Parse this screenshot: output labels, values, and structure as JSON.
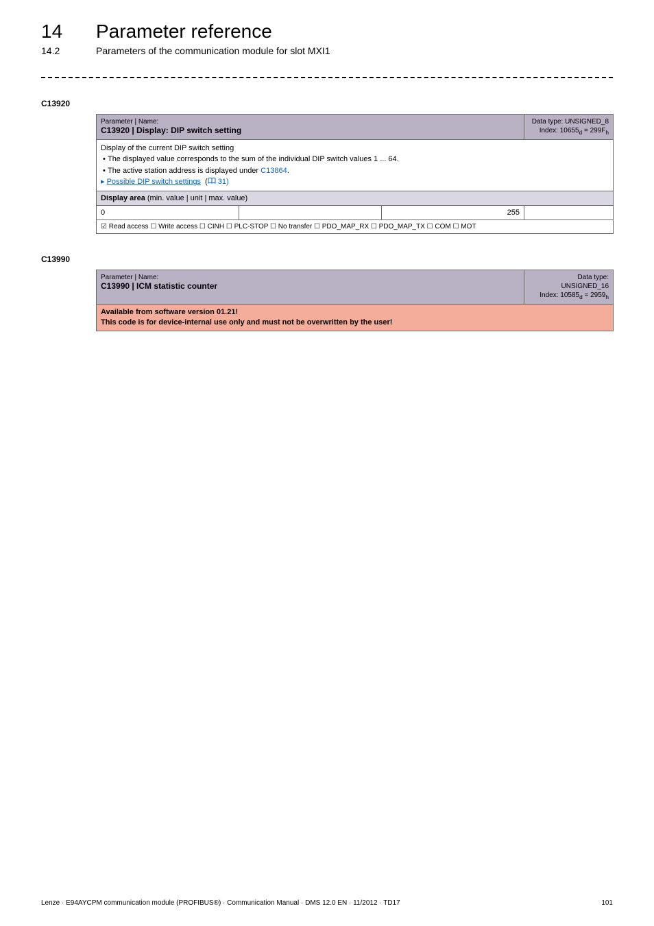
{
  "header": {
    "chapter_num": "14",
    "chapter_title": "Parameter reference",
    "section_num": "14.2",
    "section_title": "Parameters of the communication module for slot MXI1"
  },
  "param1": {
    "code": "C13920",
    "name_label": "Parameter | Name:",
    "name_value": "C13920 | Display: DIP switch setting",
    "data_type_line": "Data type: UNSIGNED_8",
    "index_line": "Index: 10655d = 299Fh",
    "desc_line1": "Display of the current DIP switch setting",
    "desc_bullet1a": "The displayed value corresponds to the sum of the individual DIP switch values 1 ... 64.",
    "desc_bullet2_prefix": "The active station address is displayed under ",
    "desc_bullet2_link": "C13864",
    "desc_bullet2_suffix": ".",
    "desc_link_prefix": "▸ ",
    "desc_link_text": "Possible DIP switch settings",
    "desc_link_page": " 31)",
    "display_area_label": "Display area (min. value | unit | max. value)",
    "display_min": "0",
    "display_max": "255",
    "access_line": "☑ Read access   ☐ Write access   ☐ CINH   ☐ PLC-STOP   ☐ No transfer   ☐ PDO_MAP_RX   ☐ PDO_MAP_TX   ☐ COM   ☐ MOT"
  },
  "param2": {
    "code": "C13990",
    "name_label": "Parameter | Name:",
    "name_value": "C13990 | ICM statistic counter",
    "data_type_line": "Data type: UNSIGNED_16",
    "index_line": "Index: 10585d = 2959h",
    "warn_line1": "Available from software version 01.21!",
    "warn_line2": "This code is for device-internal use only and must not be overwritten by the user!"
  },
  "footer": {
    "left": "Lenze · E94AYCPM communication module (PROFIBUS®) · Communication Manual · DMS 12.0 EN · 11/2012 · TD17",
    "right": "101"
  }
}
